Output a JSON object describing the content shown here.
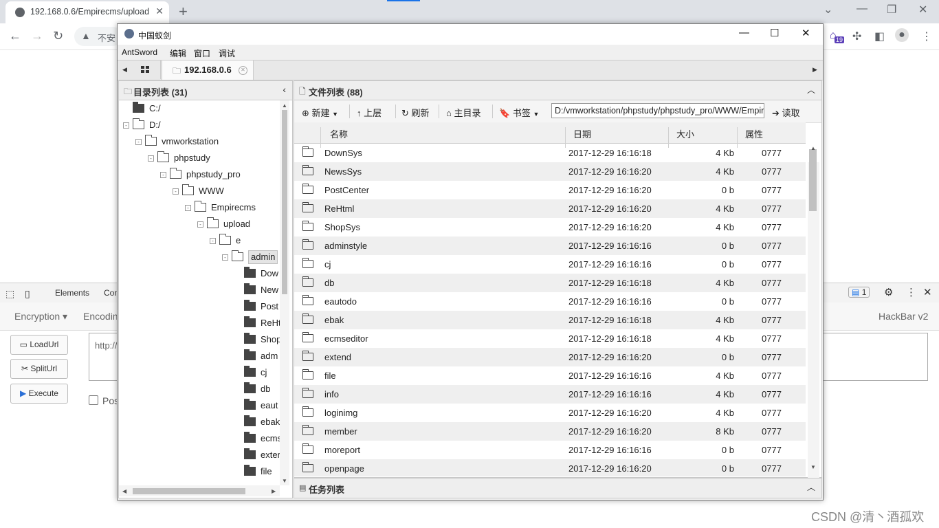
{
  "browser": {
    "tab_title": "192.168.0.6/Empirecms/upload",
    "tab_close": "✕",
    "new_tab": "+",
    "address_text": "不安",
    "extension_badge": "19"
  },
  "devtools": {
    "tab_elements": "Elements",
    "tab_console": "Con",
    "issues_count": "1"
  },
  "hackbar": {
    "encryption": "Encryption",
    "encoding": "Encodin",
    "brand": "HackBar v2",
    "load_url": "LoadUrl",
    "split_url": "SplitUrl",
    "execute": "Execute",
    "url_value": "http://",
    "post_label": "Pos"
  },
  "watermark": "CSDN @清丶酒孤欢",
  "antsword": {
    "window_title": "中国蚁剑",
    "menu": [
      "AntSword",
      "编辑",
      "窗口",
      "调试"
    ],
    "host_tab": "192.168.0.6",
    "dir_panel": {
      "title": "目录列表 (31)",
      "tree": [
        {
          "label": "C:/",
          "type": "solid",
          "level": 0,
          "toggle": ""
        },
        {
          "label": "D:/",
          "type": "open",
          "level": 0,
          "toggle": "-"
        },
        {
          "label": "vmworkstation",
          "type": "open",
          "level": 1,
          "toggle": "-"
        },
        {
          "label": "phpstudy",
          "type": "open",
          "level": 2,
          "toggle": "-"
        },
        {
          "label": "phpstudy_pro",
          "type": "open",
          "level": 3,
          "toggle": "-"
        },
        {
          "label": "WWW",
          "type": "open",
          "level": 4,
          "toggle": "-"
        },
        {
          "label": "Empirecms",
          "type": "open",
          "level": 5,
          "toggle": "-"
        },
        {
          "label": "upload",
          "type": "open",
          "level": 6,
          "toggle": "-"
        },
        {
          "label": "e",
          "type": "open",
          "level": 7,
          "toggle": "-"
        },
        {
          "label": "admin",
          "type": "open",
          "level": 8,
          "toggle": "-",
          "selected": true
        },
        {
          "label": "Dow",
          "type": "solid",
          "level": 9,
          "toggle": ""
        },
        {
          "label": "New",
          "type": "solid",
          "level": 9,
          "toggle": ""
        },
        {
          "label": "Post",
          "type": "solid",
          "level": 9,
          "toggle": ""
        },
        {
          "label": "ReHt",
          "type": "solid",
          "level": 9,
          "toggle": ""
        },
        {
          "label": "Shop",
          "type": "solid",
          "level": 9,
          "toggle": ""
        },
        {
          "label": "adm",
          "type": "solid",
          "level": 9,
          "toggle": ""
        },
        {
          "label": "cj",
          "type": "solid",
          "level": 9,
          "toggle": ""
        },
        {
          "label": "db",
          "type": "solid",
          "level": 9,
          "toggle": ""
        },
        {
          "label": "eaut",
          "type": "solid",
          "level": 9,
          "toggle": ""
        },
        {
          "label": "ebak",
          "type": "solid",
          "level": 9,
          "toggle": ""
        },
        {
          "label": "ecms",
          "type": "solid",
          "level": 9,
          "toggle": ""
        },
        {
          "label": "exter",
          "type": "solid",
          "level": 9,
          "toggle": ""
        },
        {
          "label": "file",
          "type": "solid",
          "level": 9,
          "toggle": ""
        }
      ]
    },
    "file_panel": {
      "title": "文件列表 (88)",
      "toolbar": {
        "new": "新建",
        "up": "上层",
        "refresh": "刷新",
        "home": "主目录",
        "bookmark": "书签",
        "path": "D:/vmworkstation/phpstudy/phpstudy_pro/WWW/Empirecms/upload/e/admin/",
        "read": "读取"
      },
      "columns": {
        "name": "名称",
        "date": "日期",
        "size": "大小",
        "attr": "属性"
      },
      "files": [
        {
          "name": "DownSys",
          "date": "2017-12-29 16:16:18",
          "size": "4 Kb",
          "attr": "0777"
        },
        {
          "name": "NewsSys",
          "date": "2017-12-29 16:16:20",
          "size": "4 Kb",
          "attr": "0777"
        },
        {
          "name": "PostCenter",
          "date": "2017-12-29 16:16:20",
          "size": "0 b",
          "attr": "0777"
        },
        {
          "name": "ReHtml",
          "date": "2017-12-29 16:16:20",
          "size": "4 Kb",
          "attr": "0777"
        },
        {
          "name": "ShopSys",
          "date": "2017-12-29 16:16:20",
          "size": "4 Kb",
          "attr": "0777"
        },
        {
          "name": "adminstyle",
          "date": "2017-12-29 16:16:16",
          "size": "0 b",
          "attr": "0777"
        },
        {
          "name": "cj",
          "date": "2017-12-29 16:16:16",
          "size": "0 b",
          "attr": "0777"
        },
        {
          "name": "db",
          "date": "2017-12-29 16:16:18",
          "size": "4 Kb",
          "attr": "0777"
        },
        {
          "name": "eautodo",
          "date": "2017-12-29 16:16:16",
          "size": "0 b",
          "attr": "0777"
        },
        {
          "name": "ebak",
          "date": "2017-12-29 16:16:18",
          "size": "4 Kb",
          "attr": "0777"
        },
        {
          "name": "ecmseditor",
          "date": "2017-12-29 16:16:18",
          "size": "4 Kb",
          "attr": "0777"
        },
        {
          "name": "extend",
          "date": "2017-12-29 16:16:20",
          "size": "0 b",
          "attr": "0777"
        },
        {
          "name": "file",
          "date": "2017-12-29 16:16:16",
          "size": "4 Kb",
          "attr": "0777"
        },
        {
          "name": "info",
          "date": "2017-12-29 16:16:16",
          "size": "4 Kb",
          "attr": "0777"
        },
        {
          "name": "loginimg",
          "date": "2017-12-29 16:16:20",
          "size": "4 Kb",
          "attr": "0777"
        },
        {
          "name": "member",
          "date": "2017-12-29 16:16:20",
          "size": "8 Kb",
          "attr": "0777"
        },
        {
          "name": "moreport",
          "date": "2017-12-29 16:16:16",
          "size": "0 b",
          "attr": "0777"
        },
        {
          "name": "openpage",
          "date": "2017-12-29 16:16:20",
          "size": "0 b",
          "attr": "0777"
        }
      ]
    },
    "task_panel": {
      "title": "任务列表"
    }
  }
}
